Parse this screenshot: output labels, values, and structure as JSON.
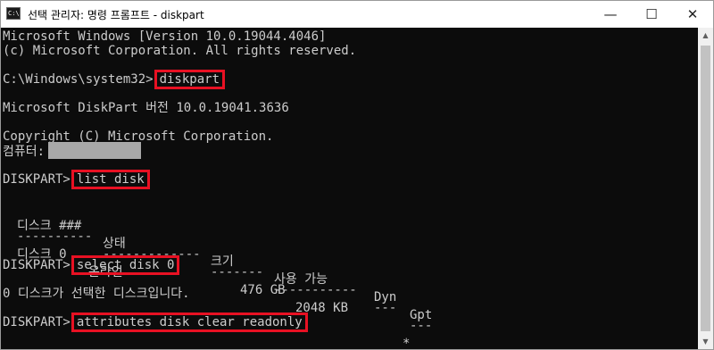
{
  "window": {
    "title": "선택 관리자: 명령 프롬프트 - diskpart",
    "icon_text": "C:\\."
  },
  "controls": {
    "minimize": "—",
    "maximize": "☐",
    "close": "✕"
  },
  "console": {
    "lines": [
      "Microsoft Windows [Version 10.0.19044.4046]",
      "(c) Microsoft Corporation. All rights reserved.",
      "C:\\Windows\\system32>",
      "Microsoft DiskPart 버전 10.0.19041.3636",
      "Copyright (C) Microsoft Corporation.",
      "컴퓨터:",
      "DISKPART>",
      "DISKPART>",
      "0 디스크가 선택한 디스크입니다.",
      "DISKPART>"
    ],
    "commands": {
      "diskpart": "diskpart",
      "list_disk": "list disk",
      "select_disk": "select disk 0",
      "attributes": "attributes disk clear readonly"
    },
    "table": {
      "headers": [
        "디스크 ###",
        "상태",
        "크기",
        "사용 가능",
        "Dyn",
        "Gpt"
      ],
      "underlines": [
        "----------",
        "-------------",
        "-------",
        "-----------",
        "---",
        "---"
      ],
      "row": [
        "디스크 0",
        "온라인",
        "476 GB",
        "2048 KB",
        "",
        "*"
      ]
    }
  },
  "scrollbar": {
    "up": "▲",
    "down": "▼"
  }
}
